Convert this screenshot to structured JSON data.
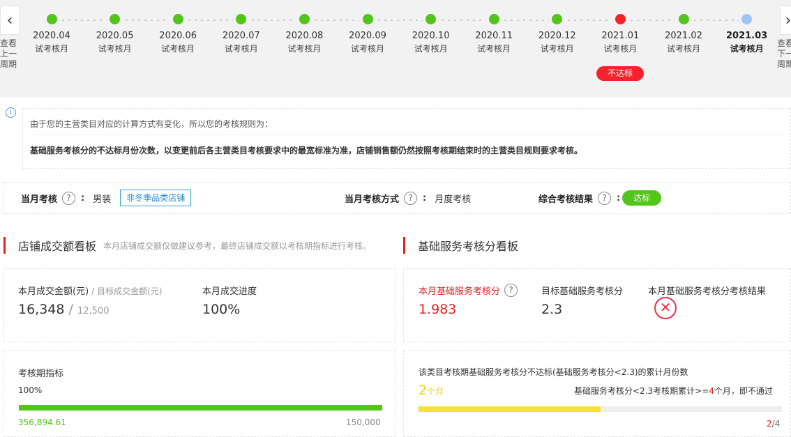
{
  "timeline": {
    "prev_label": "查看上一周期",
    "next_label": "查看下一周期",
    "nodes": [
      {
        "date": "2020.04",
        "label": "试考核月",
        "status": "pass"
      },
      {
        "date": "2020.05",
        "label": "试考核月",
        "status": "pass"
      },
      {
        "date": "2020.06",
        "label": "试考核月",
        "status": "pass"
      },
      {
        "date": "2020.07",
        "label": "试考核月",
        "status": "pass"
      },
      {
        "date": "2020.08",
        "label": "试考核月",
        "status": "pass"
      },
      {
        "date": "2020.09",
        "label": "试考核月",
        "status": "pass"
      },
      {
        "date": "2020.10",
        "label": "试考核月",
        "status": "pass"
      },
      {
        "date": "2020.11",
        "label": "试考核月",
        "status": "pass"
      },
      {
        "date": "2020.12",
        "label": "试考核月",
        "status": "pass"
      },
      {
        "date": "2021.01",
        "label": "试考核月",
        "status": "fail"
      },
      {
        "date": "2021.02",
        "label": "试考核月",
        "status": "pass"
      },
      {
        "date": "2021.03",
        "label": "试考核月",
        "status": "current"
      }
    ],
    "fail_badge": "不达标"
  },
  "notice": {
    "line1": "由于您的主营类目对应的计算方式有变化，所以您的考核规则为：",
    "line2": "基础服务考核分的不达标月份次数，以变更前后各主营类目考核要求中的最宽标准为准，店铺销售额仍然按照考核期结束时的主营类目规则要求考核。"
  },
  "assessment": {
    "month_label": "当月考核",
    "month_category": "男装",
    "month_tag": "非冬季品类店铺",
    "method_label": "当月考核方式",
    "method_value": "月度考核",
    "result_label": "综合考核结果",
    "result_value": "达标"
  },
  "sales_board": {
    "title": "店铺成交额看板",
    "subtitle": "本月店铺成交额仅做建议参考，最终店铺成交额以考核期指标进行考核。",
    "amount_label": "本月成交金额(元)",
    "target_label": "/ 目标成交金额(元)",
    "amount_value": "16,348",
    "target_value": "12,500",
    "progress_label": "本月成交进度",
    "progress_value": "100%",
    "period_label": "考核期指标",
    "period_percent": "100%",
    "period_progress": 1.0,
    "period_actual": "356,894.61",
    "period_target": "150,000",
    "bar_color": "#52c41a"
  },
  "service_board": {
    "title": "基础服务考核分看板",
    "score_label": "本月基础服务考核分",
    "score_value": "1.983",
    "target_label": "目标基础服务考核分",
    "target_value": "2.3",
    "result_label": "本月基础服务考核分考核结果",
    "fail_months_title": "该类目考核期基础服务考核分不达标(基础服务考核分<2.3)的累计月份数",
    "fail_months_value": "2",
    "fail_months_unit": "个月",
    "rule_prefix": "基础服务考核分<2.3考核期累计>=",
    "rule_count": "4",
    "rule_suffix": "个月，即不通过",
    "progress_current": "2",
    "progress_total": "/4",
    "progress_fraction": 0.5,
    "bar_color": "#f5e236"
  }
}
